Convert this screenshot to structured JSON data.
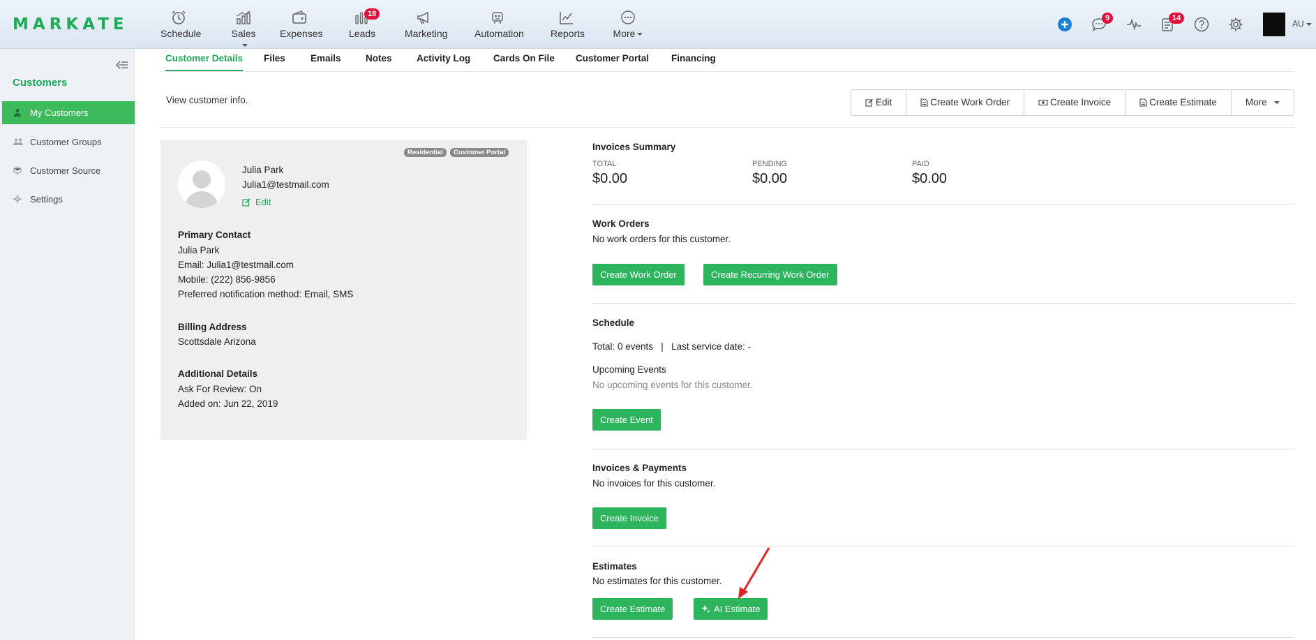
{
  "brand": {
    "logo": "MARKATE",
    "accent": "#1faa5a"
  },
  "nav": {
    "items": [
      {
        "label": "Schedule",
        "icon": "alarm-clock-icon"
      },
      {
        "label": "Sales",
        "icon": "sales-chart-icon",
        "dropdown": true
      },
      {
        "label": "Expenses",
        "icon": "wallet-icon"
      },
      {
        "label": "Leads",
        "icon": "leads-icon",
        "badge": "18"
      },
      {
        "label": "Marketing",
        "icon": "megaphone-icon"
      },
      {
        "label": "Automation",
        "icon": "robot-icon"
      },
      {
        "label": "Reports",
        "icon": "line-chart-icon"
      },
      {
        "label": "More",
        "icon": "more-dots-icon",
        "dropdown": true
      }
    ],
    "messages_badge": "9",
    "tasks_badge": "14",
    "user_initials": "AU"
  },
  "sidebar": {
    "title": "Customers",
    "items": [
      {
        "label": "My Customers",
        "active": true
      },
      {
        "label": "Customer Groups"
      },
      {
        "label": "Customer Source"
      },
      {
        "label": "Settings"
      }
    ]
  },
  "tabs": [
    "Customer Details",
    "Files",
    "Emails",
    "Notes",
    "Activity Log",
    "Cards On File",
    "Customer Portal",
    "Financing"
  ],
  "header": {
    "info": "View customer info.",
    "actions": [
      "Edit",
      "Create Work Order",
      "Create Invoice",
      "Create Estimate",
      "More"
    ]
  },
  "customer": {
    "tags": [
      "Residential",
      "Customer Portal"
    ],
    "name": "Julia Park",
    "email": "Julia1@testmail.com",
    "edit_label": "Edit",
    "primary_contact_heading": "Primary Contact",
    "contact_name": "Julia Park",
    "contact_email": "Email: Julia1@testmail.com",
    "contact_mobile": "Mobile: (222) 856-9856",
    "notification": "Preferred notification method: Email, SMS",
    "billing_heading": "Billing Address",
    "billing_address": "Scottsdale Arizona",
    "additional_heading": "Additional Details",
    "ask_review": "Ask For Review: On",
    "added_on": "Added on: Jun 22, 2019"
  },
  "invoices_summary": {
    "title": "Invoices Summary",
    "total_label": "TOTAL",
    "total": "$0.00",
    "pending_label": "PENDING",
    "pending": "$0.00",
    "paid_label": "PAID",
    "paid": "$0.00"
  },
  "work_orders": {
    "title": "Work Orders",
    "empty": "No work orders for this customer.",
    "create": "Create Work Order",
    "create_recurring": "Create Recurring Work Order"
  },
  "schedule": {
    "title": "Schedule",
    "summary": "Total: 0 events   |   Last service date: -",
    "upcoming_title": "Upcoming Events",
    "upcoming_empty": "No upcoming events for this customer.",
    "create": "Create Event"
  },
  "invoices_payments": {
    "title": "Invoices & Payments",
    "empty": "No invoices for this customer.",
    "create": "Create Invoice"
  },
  "estimates": {
    "title": "Estimates",
    "empty": "No estimates for this customer.",
    "create": "Create Estimate",
    "ai": "AI Estimate"
  }
}
